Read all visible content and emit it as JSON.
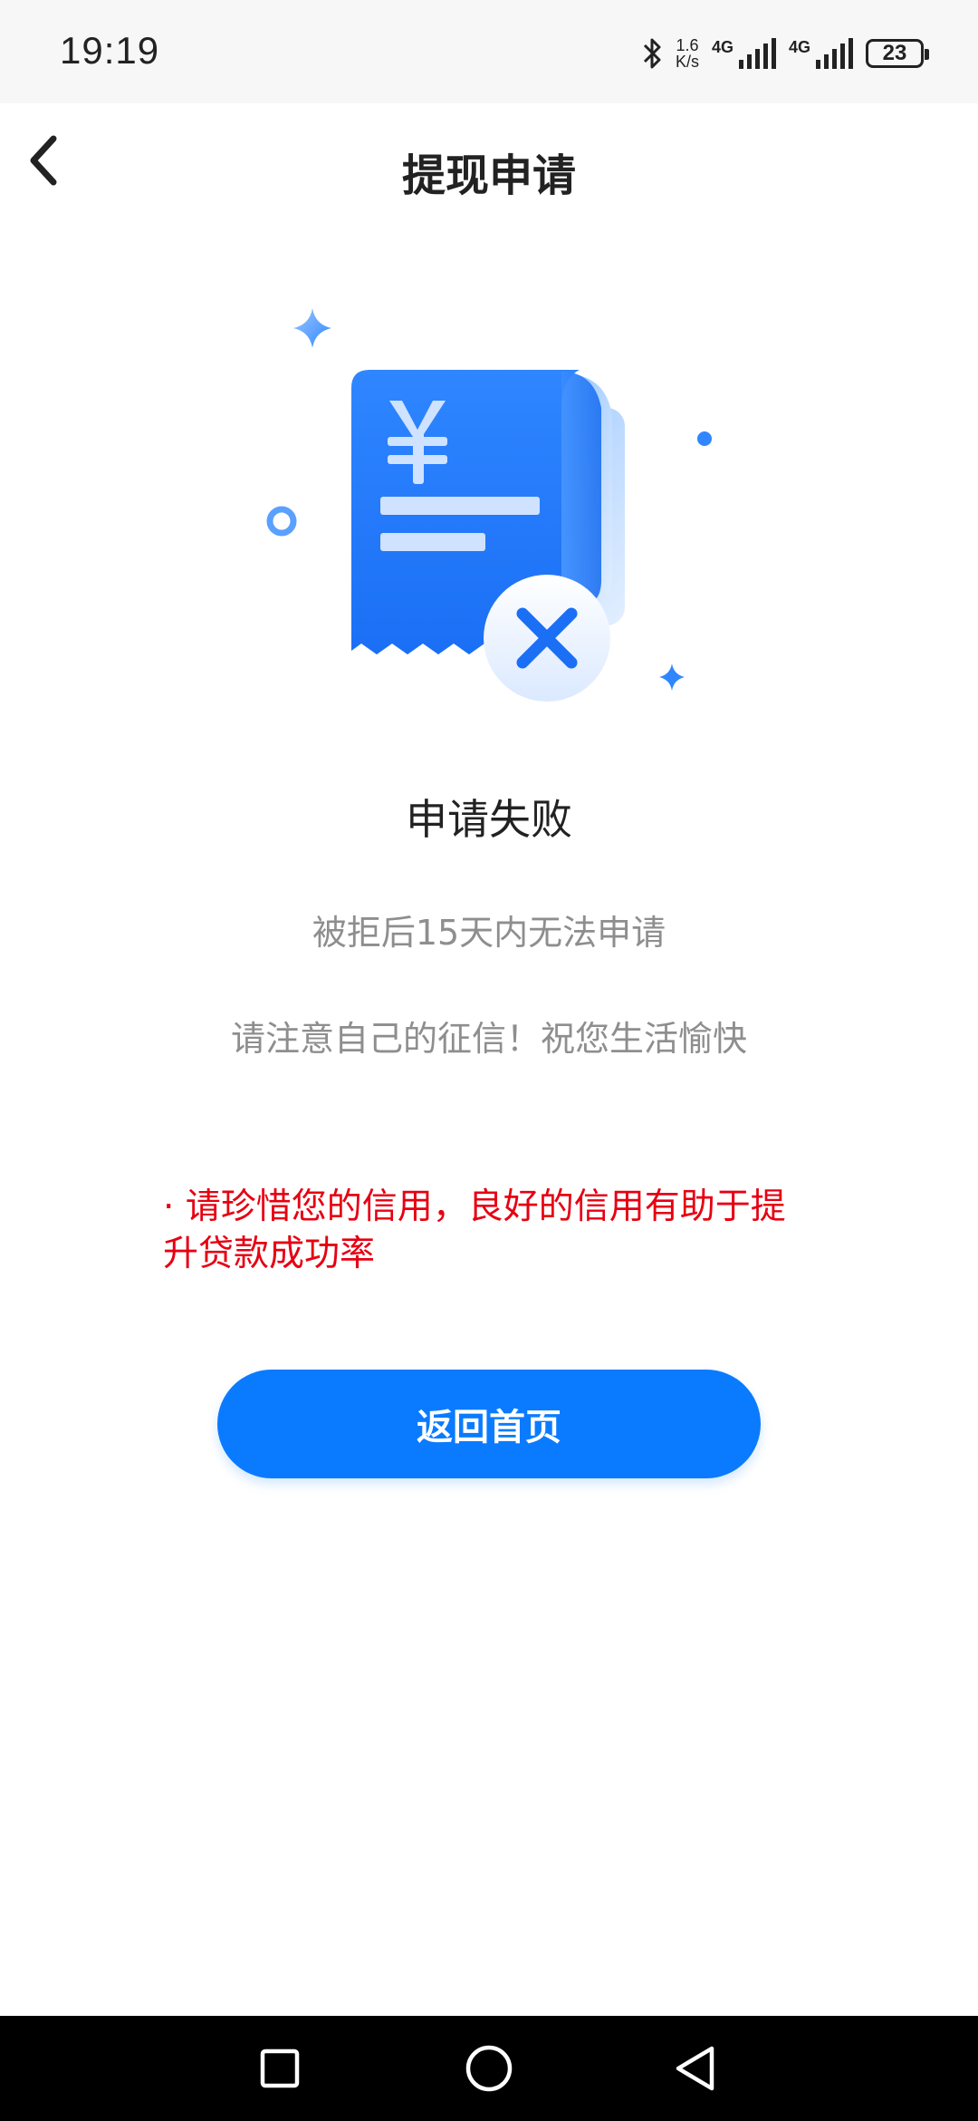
{
  "status_bar": {
    "time": "19:19",
    "net_speed_value": "1.6",
    "net_speed_unit": "K/s",
    "sim1_label": "4G",
    "sim2_label": "4G",
    "battery_level": "23"
  },
  "header": {
    "title": "提现申请",
    "back_icon": "chevron-left-icon"
  },
  "illustration": {
    "icon": "failed-receipt-icon",
    "currency_symbol": "¥",
    "primary_color": "#1677ff",
    "light_color": "#d9e9ff"
  },
  "result": {
    "title": "申请失败",
    "line1": "被拒后15天内无法申请",
    "line2": "请注意自己的征信！祝您生活愉快"
  },
  "warning": {
    "text": "· 请珍惜您的信用，良好的信用有助于提升贷款成功率",
    "color": "#e60012"
  },
  "actions": {
    "home_button_label": "返回首页",
    "button_color": "#0a7bff"
  },
  "nav_bar": {
    "recents_icon": "square-icon",
    "home_icon": "circle-icon",
    "back_icon": "triangle-back-icon"
  }
}
